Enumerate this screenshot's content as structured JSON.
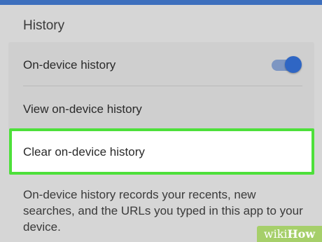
{
  "section": {
    "title": "History"
  },
  "items": [
    {
      "label": "On-device history",
      "toggle_on": true
    },
    {
      "label": "View on-device history"
    },
    {
      "label": "Clear on-device history"
    }
  ],
  "description": "On-device history records your recents, new searches, and the URLs you typed in this app to your device.",
  "watermark": {
    "prefix": "wiki",
    "suffix": "How"
  },
  "colors": {
    "accent": "#2f66c4",
    "highlight_border": "#4de03a",
    "background": "#d6d6d6",
    "top_bar": "#3d6fbd"
  }
}
